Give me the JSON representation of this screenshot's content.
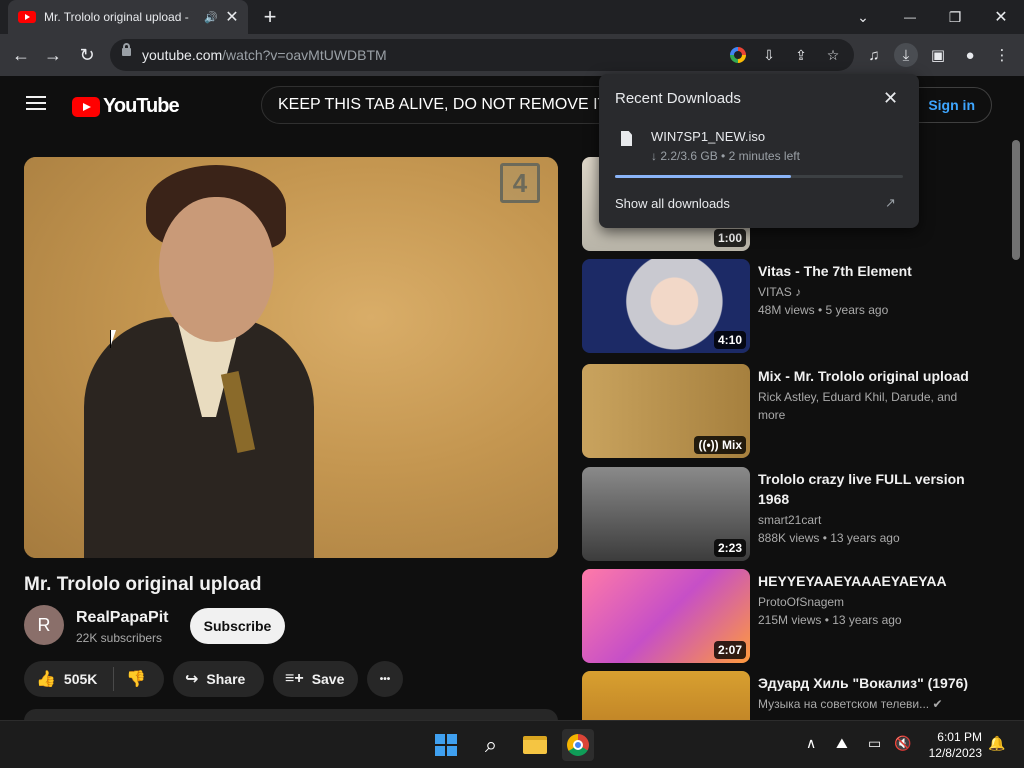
{
  "browser": {
    "tab": {
      "title": "Mr. Trololo original upload -",
      "audio_icon": "speaker-icon",
      "close": "✕"
    },
    "new_tab": "+",
    "window_controls": {
      "tab_search": "⌄",
      "minimize": "—",
      "restore": "❐",
      "close": "✕"
    },
    "url": {
      "host": "youtube.com",
      "path": "/watch?v=oavMtUWDBTM"
    }
  },
  "youtube": {
    "logo_text": "YouTube",
    "search_value": "KEEP THIS TAB ALIVE,  DO NOT REMOVE IT.",
    "sign_in": "Sign in",
    "player": {
      "channel_bug": "4"
    },
    "video": {
      "title": "Mr. Trololo original upload",
      "channel_initial": "R",
      "channel": "RealPapaPit",
      "subscribers": "22K subscribers",
      "subscribe": "Subscribe",
      "likes": "505K",
      "share": "Share",
      "save": "Save",
      "more": "•••"
    },
    "related": [
      {
        "title": "",
        "channel": "",
        "meta": "",
        "duration": "1:00"
      },
      {
        "title": "Vitas - The 7th Element",
        "channel": "VITAS ♪",
        "meta": "48M views  • 5 years ago",
        "duration": "4:10"
      },
      {
        "title": "Mix - Mr. Trololo original upload",
        "channel": "Rick Astley, Eduard Khil, Darude, and",
        "channel2": "more",
        "meta": "",
        "duration": "((•)) Mix"
      },
      {
        "title": "Trololo crazy live FULL version 1968",
        "channel": "smart21cart",
        "meta": "888K views  • 13 years ago",
        "duration": "2:23"
      },
      {
        "title": "HEYYEYAAEYAAAEYAEYAA",
        "channel": "ProtoOfSnagem",
        "meta": "215M views  • 13 years ago",
        "duration": "2:07"
      },
      {
        "title": "Эдуард Хиль \"Вокализ\" (1976)",
        "channel": "Музыка на советском телеви... ✔",
        "meta": "",
        "duration": ""
      }
    ]
  },
  "downloads_popup": {
    "title": "Recent Downloads",
    "close": "✕",
    "file_name": "WIN7SP1_NEW.iso",
    "status": "↓ 2.2/3.6 GB • 2 minutes left",
    "progress": 0.61,
    "show_all": "Show all downloads",
    "external": "↗"
  },
  "taskbar": {
    "time": "6:01 PM",
    "date": "12/8/2023",
    "colors": {
      "accent": "#3fa0f0"
    }
  },
  "colors": {
    "yt_red": "#ff0000",
    "link_blue": "#3ea6ff",
    "progress_blue": "#8ab4f8"
  }
}
